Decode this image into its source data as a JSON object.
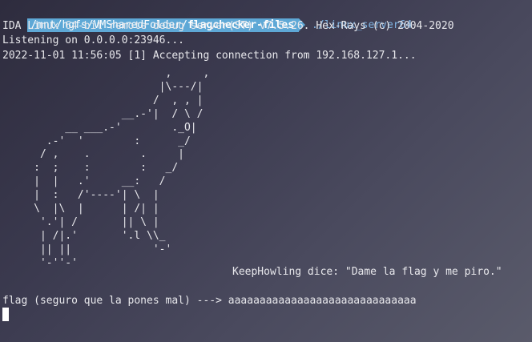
{
  "prompt": {
    "path_prefix": "/mnt/hgfs/VMSharedFolder/",
    "path_bold": "flagchecker-files",
    "command": "./linux_server64"
  },
  "output": {
    "line1": "IDA Linux 64-bit remote debug server(ST) v7.5.26. Hex-Rays (c) 2004-2020",
    "line2": "Listening on 0.0.0.0:23946...",
    "line3": "2022-11-01 11:56:05 [1] Accepting connection from 192.168.127.1..."
  },
  "ascii_art": "                          ,     ,\n                         |\\---/|\n                        /  , , |\n                   __.-'|  / \\ /\n          __ ___.-'        ._O|\n       .-'  '        :      _/\n      / ,    .        .     |\n     :  ;    :        :   _/\n     |  |   .'     __:   /\n     |  :   /'----'| \\  |\n     \\  |\\  |      | /| |\n      '.'| /       || \\ |\n      | /|.'       '.l \\\\_\n      || ||             '-'\n      '-''-'",
  "dice_text": "KeepHowling dice: \"Dame la flag y me piro.\"",
  "input_prompt": "flag (seguro que la pones mal) ---> aaaaaaaaaaaaaaaaaaaaaaaaaaaaaa"
}
